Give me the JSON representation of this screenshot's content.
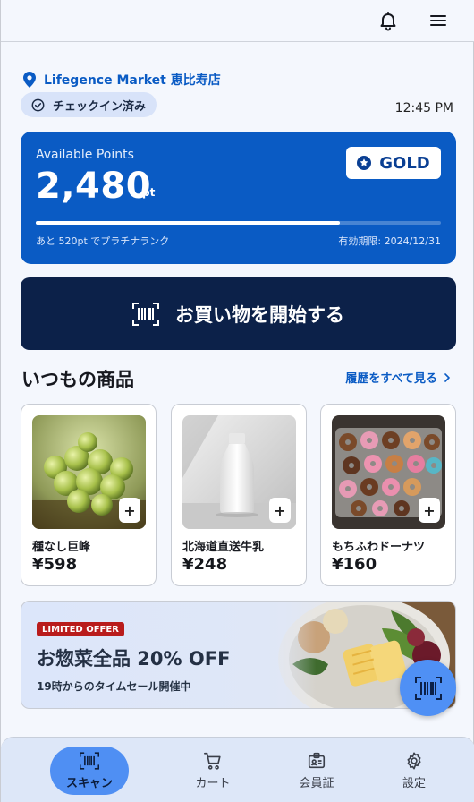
{
  "header": {
    "bell_icon": "bell-icon",
    "menu_icon": "hamburger-menu-icon"
  },
  "store": {
    "name": "Lifegence Market 恵比寿店",
    "checkin_label": "チェックイン済み",
    "time": "12:45 PM"
  },
  "points": {
    "label": "Available Points",
    "value": "2,480",
    "unit": "pt",
    "rank": "GOLD",
    "progress": 0.75,
    "next_rank_text": "あと 520pt でプラチナランク",
    "expiry_text": "有効期限: 2024/12/31"
  },
  "start_button": {
    "label": "お買い物を開始する"
  },
  "usual_items": {
    "title": "いつもの商品",
    "link_label": "履歴をすべて見る",
    "items": [
      {
        "name": "種なし巨峰",
        "price": "¥598"
      },
      {
        "name": "北海道直送牛乳",
        "price": "¥248"
      },
      {
        "name": "もちふわドーナツ",
        "price": "¥160"
      }
    ],
    "add_label": "+"
  },
  "offer": {
    "tag": "LIMITED OFFER",
    "headline": "お惣菜全品 20% OFF",
    "subtitle": "19時からのタイムセール開催中"
  },
  "bottom_nav": {
    "items": [
      {
        "label": "スキャン",
        "icon": "barcode-scan-icon",
        "active": true
      },
      {
        "label": "カート",
        "icon": "cart-icon",
        "active": false
      },
      {
        "label": "会員証",
        "icon": "id-card-icon",
        "active": false
      },
      {
        "label": "設定",
        "icon": "gear-icon",
        "active": false
      }
    ]
  },
  "colors": {
    "primary": "#0a5bc4",
    "dark_button": "#0c2149",
    "accent_blue": "#4f8ff3",
    "offer_tag": "#b91c1c"
  }
}
